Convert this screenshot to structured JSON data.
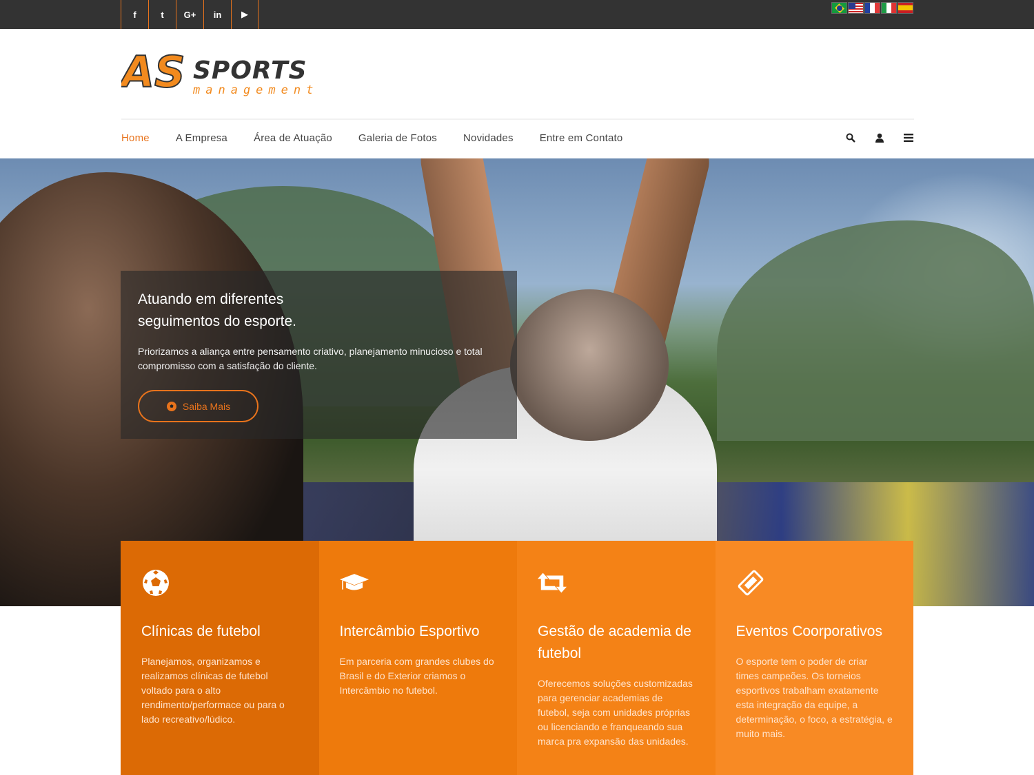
{
  "social": [
    {
      "name": "facebook",
      "glyph": "f"
    },
    {
      "name": "twitter",
      "glyph": "t"
    },
    {
      "name": "google-plus",
      "glyph": "G+"
    },
    {
      "name": "linkedin",
      "glyph": "in"
    },
    {
      "name": "youtube",
      "glyph": "▶"
    }
  ],
  "languages": [
    "brazil-flag",
    "usa-flag",
    "france-flag",
    "italy-flag",
    "spain-flag"
  ],
  "logo": {
    "initials": "AS",
    "word": "SPORTS",
    "sub": "management"
  },
  "nav": {
    "items": [
      "Home",
      "A Empresa",
      "Área de Atuação",
      "Galeria de Fotos",
      "Novidades",
      "Entre em Contato"
    ],
    "active": "Home",
    "icons": [
      "search-icon",
      "user-icon",
      "menu-icon"
    ]
  },
  "hero": {
    "title": "Atuando em diferentes seguimentos do esporte.",
    "text": "Priorizamos a aliança entre pensamento criativo, planejamento minucioso e total compromisso com a satisfação do cliente.",
    "button": "Saiba Mais"
  },
  "features": [
    {
      "icon": "soccer-ball-icon",
      "title": "Clínicas de futebol",
      "text": "Planejamos, organizamos e realizamos clínicas de futebol voltado para o alto rendimento/performace ou para o lado recreativo/lúdico."
    },
    {
      "icon": "graduation-cap-icon",
      "title": "Intercâmbio Esportivo",
      "text": "Em parceria com grandes clubes do Brasil e do Exterior criamos o Intercâmbio no futebol."
    },
    {
      "icon": "retweet-icon",
      "title": "Gestão de academia de futebol",
      "text": "Oferecemos soluções customizadas para gerenciar academias de futebol, seja com unidades próprias ou licenciando e franqueando sua marca pra expansão das unidades."
    },
    {
      "icon": "ticket-icon",
      "title": "Eventos Coorporativos",
      "text": "O esporte tem o poder de criar times campeões. Os torneios esportivos trabalham exatamente esta integração da equipe, a determinação, o foco, a estratégia, e muito mais."
    }
  ],
  "colors": {
    "accent": "#e8731c",
    "topbar": "#333333"
  }
}
